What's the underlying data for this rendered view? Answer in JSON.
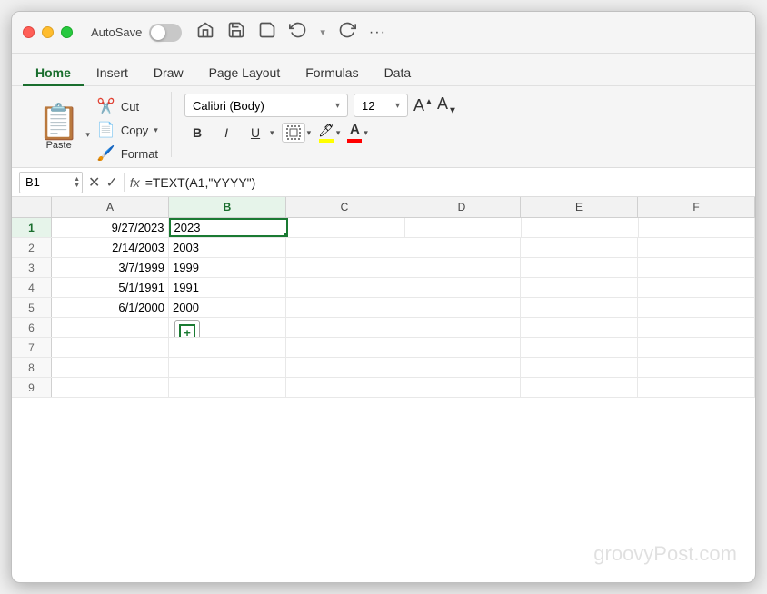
{
  "titlebar": {
    "autosave_label": "AutoSave",
    "more_options": "···"
  },
  "tabs": [
    {
      "id": "home",
      "label": "Home",
      "active": true
    },
    {
      "id": "insert",
      "label": "Insert",
      "active": false
    },
    {
      "id": "draw",
      "label": "Draw",
      "active": false
    },
    {
      "id": "page_layout",
      "label": "Page Layout",
      "active": false
    },
    {
      "id": "formulas",
      "label": "Formulas",
      "active": false
    },
    {
      "id": "data",
      "label": "Data",
      "active": false
    }
  ],
  "ribbon": {
    "paste_label": "Paste",
    "cut_label": "Cut",
    "copy_label": "Copy",
    "format_label": "Format",
    "font_name": "Calibri (Body)",
    "font_size": "12",
    "bold": "B",
    "italic": "I",
    "underline": "U"
  },
  "formula_bar": {
    "cell_ref": "B1",
    "formula": "=TEXT(A1,\"YYYY\")"
  },
  "columns": [
    "A",
    "B",
    "C",
    "D",
    "E",
    "F"
  ],
  "rows": [
    {
      "num": 1,
      "cells": [
        "9/27/2023",
        "2023",
        "",
        "",
        "",
        ""
      ]
    },
    {
      "num": 2,
      "cells": [
        "2/14/2003",
        "2003",
        "",
        "",
        "",
        ""
      ]
    },
    {
      "num": 3,
      "cells": [
        "3/7/1999",
        "1999",
        "",
        "",
        "",
        ""
      ]
    },
    {
      "num": 4,
      "cells": [
        "5/1/1991",
        "1991",
        "",
        "",
        "",
        ""
      ]
    },
    {
      "num": 5,
      "cells": [
        "6/1/2000",
        "2000",
        "",
        "",
        "",
        ""
      ]
    },
    {
      "num": 6,
      "cells": [
        "",
        "",
        "",
        "",
        "",
        ""
      ]
    },
    {
      "num": 7,
      "cells": [
        "",
        "",
        "",
        "",
        "",
        ""
      ]
    },
    {
      "num": 8,
      "cells": [
        "",
        "",
        "",
        "",
        "",
        ""
      ]
    },
    {
      "num": 9,
      "cells": [
        "",
        "",
        "",
        "",
        "",
        ""
      ]
    }
  ],
  "active_cell": {
    "row": 1,
    "col": "B"
  },
  "watermark": "groovyPost.com"
}
